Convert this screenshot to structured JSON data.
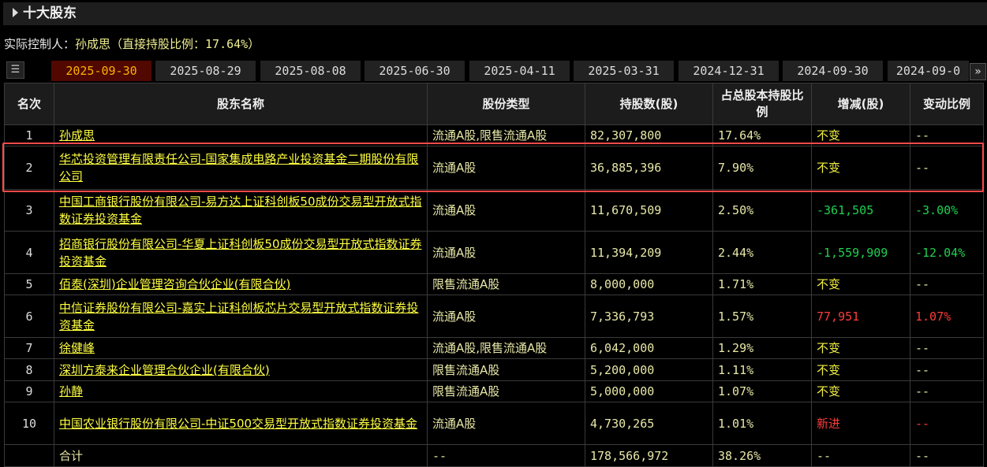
{
  "section_title": "十大股东",
  "controller": {
    "label": "实际控制人：",
    "value": "孙成思（直接持股比例：17.64%）"
  },
  "tabs": [
    "2025-09-30",
    "2025-08-29",
    "2025-08-08",
    "2025-06-30",
    "2025-04-11",
    "2025-03-31",
    "2024-12-31",
    "2024-09-30",
    "2024-09-0"
  ],
  "more_label": "»",
  "columns": [
    "名次",
    "股东名称",
    "股份类型",
    "持股数(股)",
    "占总股本持股比例",
    "增减(股)",
    "变动比例"
  ],
  "rows": [
    {
      "rank": "1",
      "name": "孙成思",
      "type": "流通A股,限售流通A股",
      "shares": "82,307,800",
      "pct": "17.64%",
      "change": "不变",
      "ratio": "--",
      "dir": "flat"
    },
    {
      "rank": "2",
      "name": "华芯投资管理有限责任公司-国家集成电路产业投资基金二期股份有限公司",
      "type": "流通A股",
      "shares": "36,885,396",
      "pct": "7.90%",
      "change": "不变",
      "ratio": "--",
      "dir": "flat"
    },
    {
      "rank": "3",
      "name": "中国工商银行股份有限公司-易方达上证科创板50成份交易型开放式指数证券投资基金",
      "type": "流通A股",
      "shares": "11,670,509",
      "pct": "2.50%",
      "change": "-361,505",
      "ratio": "-3.00%",
      "dir": "down"
    },
    {
      "rank": "4",
      "name": "招商银行股份有限公司-华夏上证科创板50成份交易型开放式指数证券投资基金",
      "type": "流通A股",
      "shares": "11,394,209",
      "pct": "2.44%",
      "change": "-1,559,909",
      "ratio": "-12.04%",
      "dir": "down"
    },
    {
      "rank": "5",
      "name": "佰泰(深圳)企业管理咨询合伙企业(有限合伙)",
      "type": "限售流通A股",
      "shares": "8,000,000",
      "pct": "1.71%",
      "change": "不变",
      "ratio": "--",
      "dir": "flat"
    },
    {
      "rank": "6",
      "name": "中信证券股份有限公司-嘉实上证科创板芯片交易型开放式指数证券投资基金",
      "type": "流通A股",
      "shares": "7,336,793",
      "pct": "1.57%",
      "change": "77,951",
      "ratio": "1.07%",
      "dir": "up"
    },
    {
      "rank": "7",
      "name": "徐健峰",
      "type": "流通A股,限售流通A股",
      "shares": "6,042,000",
      "pct": "1.29%",
      "change": "不变",
      "ratio": "--",
      "dir": "flat"
    },
    {
      "rank": "8",
      "name": "深圳方泰来企业管理合伙企业(有限合伙)",
      "type": "限售流通A股",
      "shares": "5,200,000",
      "pct": "1.11%",
      "change": "不变",
      "ratio": "--",
      "dir": "flat"
    },
    {
      "rank": "9",
      "name": "孙静",
      "type": "限售流通A股",
      "shares": "5,000,000",
      "pct": "1.07%",
      "change": "不变",
      "ratio": "--",
      "dir": "flat"
    },
    {
      "rank": "10",
      "name": "中国农业银行股份有限公司-中证500交易型开放式指数证券投资基金",
      "type": "流通A股",
      "shares": "4,730,265",
      "pct": "1.01%",
      "change": "新进",
      "ratio": "--",
      "dir": "up"
    }
  ],
  "total": {
    "label": "合计",
    "type": "--",
    "shares": "178,566,972",
    "pct": "38.26%",
    "change": "--",
    "ratio": "--"
  }
}
